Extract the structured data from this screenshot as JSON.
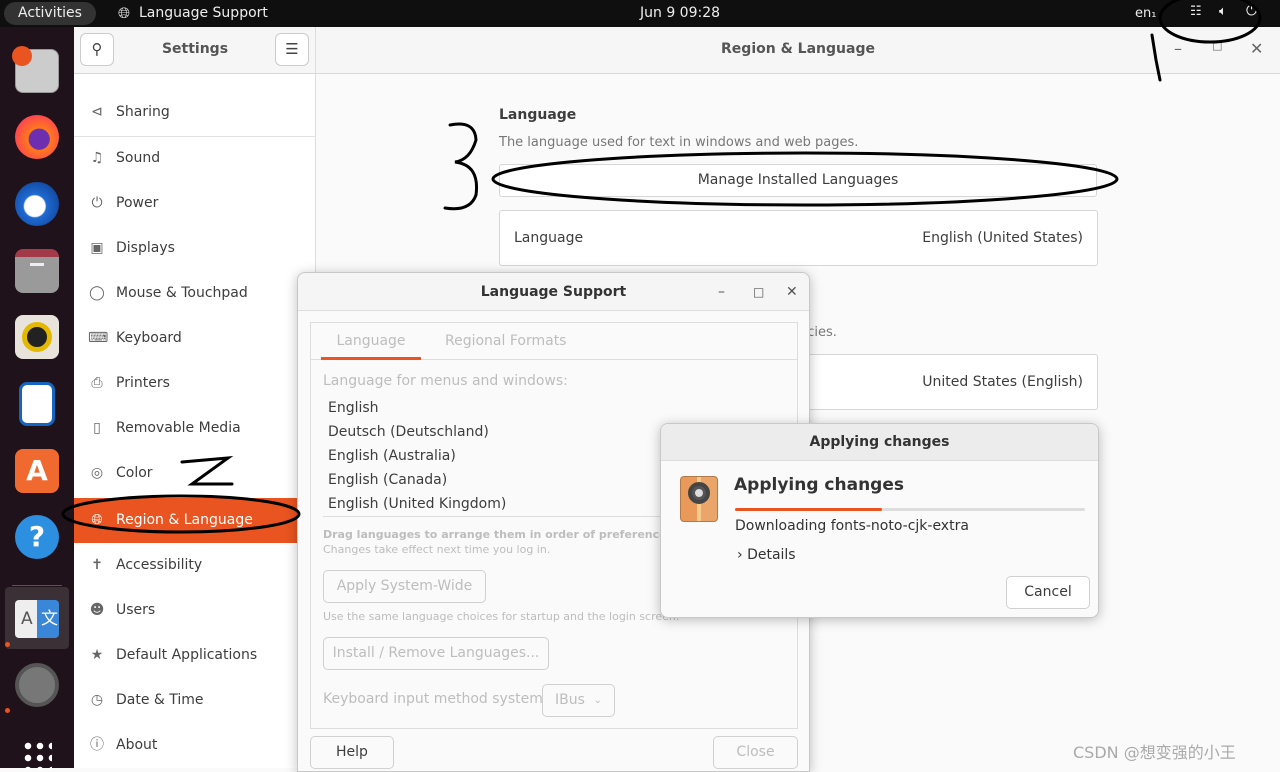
{
  "topbar": {
    "activities": "Activities",
    "app_name": "Language Support",
    "clock": "Jun 9  09:28",
    "input_lang": "en₁",
    "icons": [
      "network-icon",
      "volume-icon",
      "power-icon"
    ]
  },
  "dock": {
    "apps": [
      "disk-usage",
      "firefox",
      "thunderbird",
      "files",
      "rhythmbox",
      "libreoffice-writer",
      "app-center",
      "help",
      "language-support",
      "settings",
      "show-apps"
    ]
  },
  "settings": {
    "title": "Settings",
    "page_title": "Region & Language",
    "sidebar": [
      {
        "label": "Sharing",
        "icon": "share-icon"
      },
      {
        "label": "Sound",
        "icon": "music-note-icon"
      },
      {
        "label": "Power",
        "icon": "power-icon"
      },
      {
        "label": "Displays",
        "icon": "display-icon"
      },
      {
        "label": "Mouse & Touchpad",
        "icon": "mouse-icon"
      },
      {
        "label": "Keyboard",
        "icon": "keyboard-icon"
      },
      {
        "label": "Printers",
        "icon": "printer-icon"
      },
      {
        "label": "Removable Media",
        "icon": "usb-icon"
      },
      {
        "label": "Color",
        "icon": "color-icon"
      },
      {
        "label": "Region & Language",
        "icon": "globe-icon",
        "active": true
      },
      {
        "label": "Accessibility",
        "icon": "accessibility-icon"
      },
      {
        "label": "Users",
        "icon": "users-icon"
      },
      {
        "label": "Default Applications",
        "icon": "star-icon"
      },
      {
        "label": "Date & Time",
        "icon": "clock-icon"
      },
      {
        "label": "About",
        "icon": "info-icon"
      }
    ],
    "language_heading": "Language",
    "language_desc": "The language used for text in windows and web pages.",
    "manage_button": "Manage Installed Languages",
    "language_row_label": "Language",
    "language_row_value": "English (United States)",
    "formats_desc": "ncies.",
    "formats_value": "United States (English)"
  },
  "language_support": {
    "title": "Language Support",
    "tabs": [
      "Language",
      "Regional Formats"
    ],
    "list_label": "Language for menus and windows:",
    "languages": [
      "English",
      "Deutsch (Deutschland)",
      "English (Australia)",
      "English (Canada)",
      "English (United Kingdom)"
    ],
    "drag_hint": "Drag languages to arrange them in order of preference.",
    "drag_sub": "Changes take effect next time you log in.",
    "apply_button": "Apply System-Wide",
    "apply_hint": "Use the same language choices for startup and the login screen.",
    "install_button": "Install / Remove Languages...",
    "im_label": "Keyboard input method system:",
    "im_value": "IBus",
    "help_button": "Help",
    "close_button": "Close"
  },
  "applying": {
    "window_title": "Applying changes",
    "heading": "Applying changes",
    "progress_percent": 42,
    "status": "Downloading fonts-noto-cjk-extra",
    "details": "Details",
    "cancel_button": "Cancel"
  },
  "annotations": [
    "1",
    "2",
    "3"
  ],
  "watermark": "CSDN @想变强的小王",
  "colors": {
    "accent": "#e95420",
    "dock": "#1f121a",
    "topbar": "#0f0f0f"
  }
}
